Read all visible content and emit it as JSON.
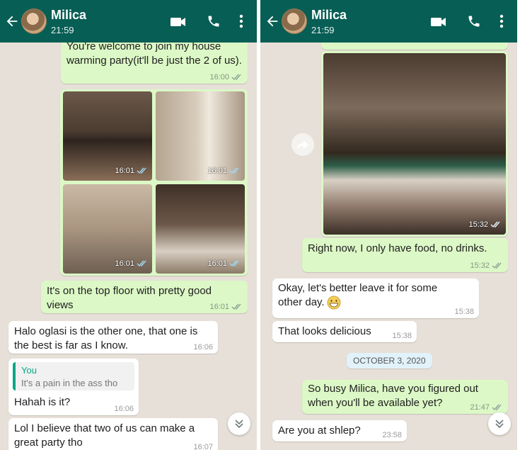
{
  "left": {
    "header": {
      "name": "Milica",
      "time": "21:59"
    },
    "messages": [
      {
        "text": "You're welcome to join my house warming party(it'll be just the 2 of us).",
        "time": "16:00"
      },
      {
        "photos": [
          {
            "time": "16:01"
          },
          {
            "time": "16:01"
          },
          {
            "time": "16:01"
          },
          {
            "time": "16:01"
          }
        ]
      },
      {
        "text": "It's on the top floor with pretty good views",
        "time": "16:01"
      },
      {
        "text": "Halo oglasi is the other one, that one is the best is far as I know.",
        "time": "16:06"
      },
      {
        "quote_author": "You",
        "quote_text": "It's a pain in the ass tho",
        "text": "Hahah is it?",
        "time": "16:06"
      },
      {
        "text": "Lol I believe that two of us can make a great party tho",
        "time": "16:07"
      }
    ]
  },
  "right": {
    "header": {
      "name": "Milica",
      "time": "21:59"
    },
    "messages": [
      {
        "photo_time": "15:32"
      },
      {
        "text": "Right now, I only have food, no drinks.",
        "time": "15:32"
      },
      {
        "text": "Okay, let's better leave it for some other day.",
        "emoji": "grinning-face",
        "time": "15:38"
      },
      {
        "text": "That looks delicious",
        "time": "15:38"
      },
      {
        "date": "OCTOBER 3, 2020"
      },
      {
        "text": "So busy Milica, have you figured out when you'll be available yet?",
        "time": "21:47"
      },
      {
        "text": "Are you at shlep?",
        "time": "23:58"
      }
    ]
  },
  "colors": {
    "header": "#075e54",
    "outgoing": "#dcf8c6",
    "incoming": "#ffffff",
    "background": "#e7e0d8",
    "quote_accent": "#06a786"
  }
}
